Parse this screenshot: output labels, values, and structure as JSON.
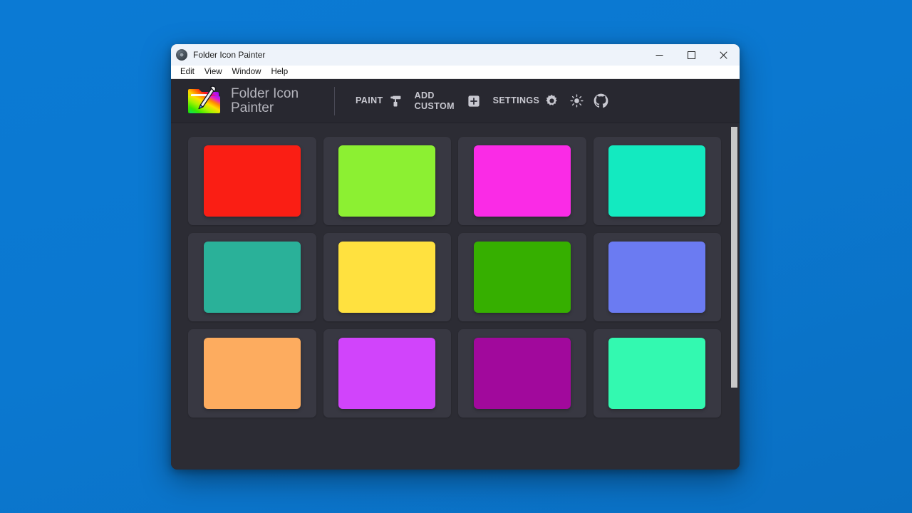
{
  "window": {
    "title": "Folder Icon Painter",
    "icon": "app-logo-icon",
    "controls": {
      "minimize": "—",
      "maximize": "☐",
      "close": "✕"
    }
  },
  "menubar": {
    "items": [
      {
        "label": "Edit"
      },
      {
        "label": "View"
      },
      {
        "label": "Window"
      },
      {
        "label": "Help"
      }
    ]
  },
  "header": {
    "logo_icon": "rainbow-folder-paintbrush-icon",
    "brand_title": "Folder Icon Painter",
    "actions": [
      {
        "label": "PAINT",
        "icon": "paint-roller-icon"
      },
      {
        "label": "ADD CUSTOM",
        "icon": "plus-square-icon"
      },
      {
        "label": "SETTINGS",
        "icon": "gear-icon"
      },
      {
        "label": "",
        "icon": "sun-icon"
      },
      {
        "label": "",
        "icon": "github-icon"
      }
    ]
  },
  "palette": {
    "swatches": [
      {
        "name": "red",
        "color": "#FA1E14"
      },
      {
        "name": "lime-green",
        "color": "#8CF032"
      },
      {
        "name": "magenta",
        "color": "#FA2BE6"
      },
      {
        "name": "turquoise",
        "color": "#13EAC0"
      },
      {
        "name": "teal",
        "color": "#2AB199"
      },
      {
        "name": "yellow",
        "color": "#FFE13F"
      },
      {
        "name": "green",
        "color": "#36AF00"
      },
      {
        "name": "periwinkle",
        "color": "#6B7BF2"
      },
      {
        "name": "light-orange",
        "color": "#FDAC5F"
      },
      {
        "name": "orchid",
        "color": "#D144FB"
      },
      {
        "name": "dark-magenta",
        "color": "#A1099C"
      },
      {
        "name": "spring-green",
        "color": "#33F9B0"
      }
    ]
  },
  "scrollbar": {
    "orientation": "vertical",
    "thumb_color": "#c8c8c8"
  },
  "theme": {
    "window_bg": "#2c2c34",
    "header_bg": "#282830",
    "card_bg": "#383842",
    "text_muted": "#c8c8d0",
    "desktop_bg": "#0b78d0"
  }
}
